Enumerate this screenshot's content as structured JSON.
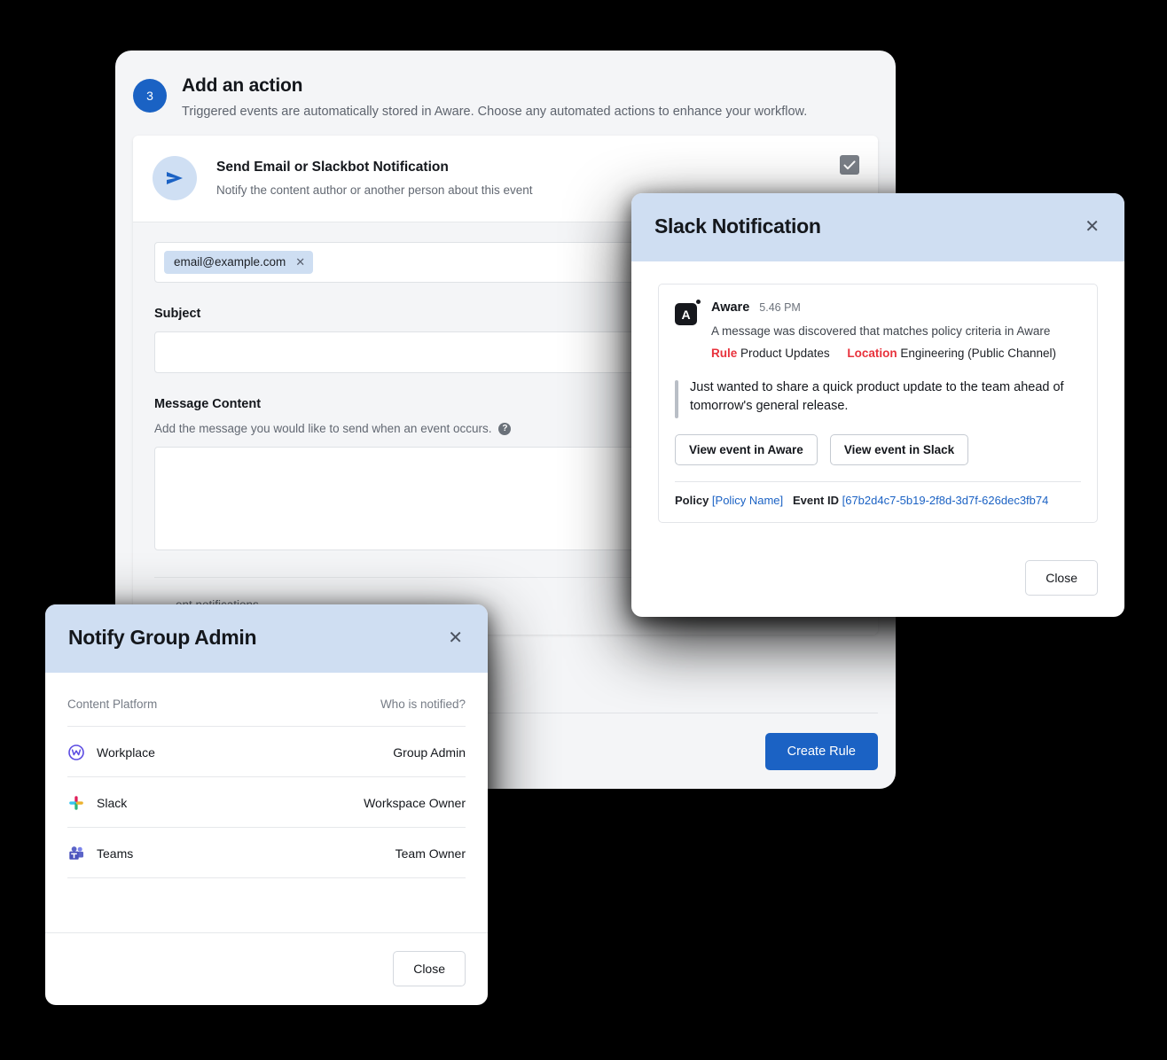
{
  "base_card": {
    "step_number": "3",
    "title": "Add an action",
    "subtitle": "Triggered events are automatically stored in Aware. Choose any automated actions to enhance your workflow.",
    "action": {
      "title": "Send Email or Slackbot Notification",
      "description": "Notify the content author or another person about this event",
      "icon": "send-paper-plane-icon",
      "checkbox_checked": true
    },
    "recipient_chip": {
      "label": "email@example.com",
      "remove_icon": "close-icon"
    },
    "subject_label": "Subject",
    "subject_value": "",
    "message_label": "Message Content",
    "message_help": "Add the message you would like to send when an event occurs.",
    "message_help_icon": "question-mark-icon",
    "message_value": "",
    "obscured_text": "ent notifications.",
    "create_rule_label": "Create Rule",
    "accent_color": "#1b62c4"
  },
  "slack_modal": {
    "title": "Slack Notification",
    "close_icon": "close-icon",
    "header_color": "#cfdef2",
    "message": {
      "app_name": "Aware",
      "avatar_letter": "A",
      "time": "5.46 PM",
      "summary": "A message was discovered that matches policy criteria in Aware",
      "rule_key": "Rule",
      "rule_value": "Product Updates",
      "location_key": "Location",
      "location_value": "Engineering (Public Channel)",
      "meta_color": "#e8323c",
      "quote": "Just wanted to share a quick product update to the team ahead of tomorrow's general release.",
      "buttons": [
        "View event in Aware",
        "View event in Slack"
      ],
      "policy_key": "Policy",
      "policy_value": "[Policy Name]",
      "event_id_key": "Event ID",
      "event_id_value": "[67b2d4c7-5b19-2f8d-3d7f-626dec3fb74",
      "link_color": "#1b62c4"
    },
    "close_label": "Close"
  },
  "notify_modal": {
    "title": "Notify Group Admin",
    "close_icon": "close-icon",
    "header_color": "#cfdef2",
    "columns": [
      "Content Platform",
      "Who is notified?"
    ],
    "rows": [
      {
        "platform": "Workplace",
        "icon": "workplace-icon",
        "notified": "Group Admin"
      },
      {
        "platform": "Slack",
        "icon": "slack-icon",
        "notified": "Workspace Owner"
      },
      {
        "platform": "Teams",
        "icon": "teams-icon",
        "notified": "Team Owner"
      }
    ],
    "close_label": "Close"
  }
}
